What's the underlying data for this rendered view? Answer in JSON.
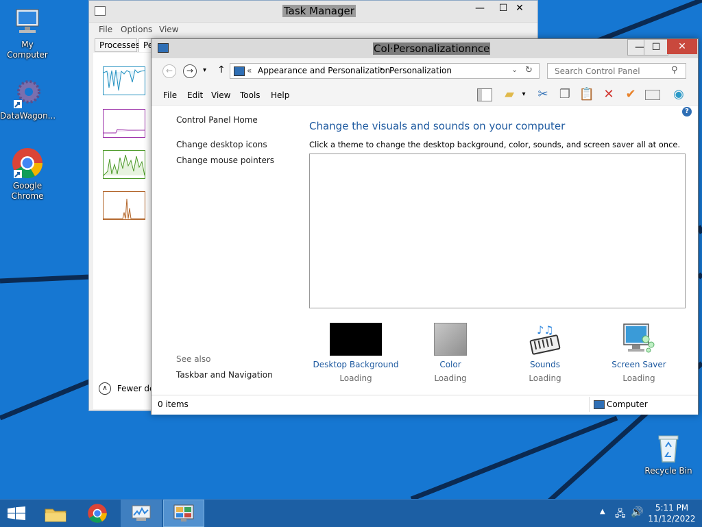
{
  "desktop": {
    "icons": [
      {
        "label": "My Computer",
        "icon": "computer-icon"
      },
      {
        "label": "DataWagon...",
        "icon": "gear-shortcut-icon"
      },
      {
        "label": "Google Chrome",
        "icon": "chrome-icon"
      },
      {
        "label": "Recycle Bin",
        "icon": "recycle-bin-icon"
      }
    ]
  },
  "task_manager": {
    "title": "Task Manager",
    "menu": [
      "File",
      "Options",
      "View"
    ],
    "tabs": [
      "Processes",
      "Pe"
    ],
    "fewer_details": "Fewer det",
    "controls": {
      "minimize": "—",
      "maximize": "☐",
      "close": "✕"
    }
  },
  "control_panel": {
    "title": "Col·Personalizationnce",
    "controls": {
      "minimize": "—",
      "maximize": "☐",
      "close": "✕"
    },
    "nav": {
      "back": "←",
      "forward": "→",
      "recent": "▾",
      "up": "↑"
    },
    "breadcrumb": {
      "chevron": "«",
      "parent": "Appearance and Personalization",
      "separator": "▸",
      "current": "Personalization"
    },
    "search_placeholder": "Search Control Panel",
    "menu": [
      "File",
      "Edit",
      "View",
      "Tools",
      "Help"
    ],
    "sidebar": {
      "home": "Control Panel Home",
      "links": [
        "Change desktop icons",
        "Change mouse pointers"
      ],
      "see_also_heading": "See also",
      "see_also_links": [
        "Taskbar and Navigation"
      ]
    },
    "main": {
      "heading": "Change the visuals and sounds on your computer",
      "description": "Click a theme to change the desktop background, color, sounds, and screen saver all at once.",
      "items": [
        {
          "label": "Desktop Background",
          "status": "Loading",
          "icon": "desktop-background-icon"
        },
        {
          "label": "Color",
          "status": "Loading",
          "icon": "color-swatch-icon"
        },
        {
          "label": "Sounds",
          "status": "Loading",
          "icon": "sounds-icon"
        },
        {
          "label": "Screen Saver",
          "status": "Loading",
          "icon": "screen-saver-icon"
        }
      ]
    },
    "status": {
      "items": "0 items",
      "location": "Computer"
    },
    "help": "?"
  },
  "taskbar": {
    "apps": [
      "start-icon",
      "file-explorer-icon",
      "chrome-icon",
      "task-manager-icon",
      "control-panel-icon"
    ],
    "clock": {
      "time": "5:11 PM",
      "date": "11/12/2022"
    }
  },
  "colors": {
    "desktop": "#1677d2",
    "taskbar": "#1c5fa4",
    "link": "#1e5aa0",
    "heading": "#1e5aa0"
  }
}
